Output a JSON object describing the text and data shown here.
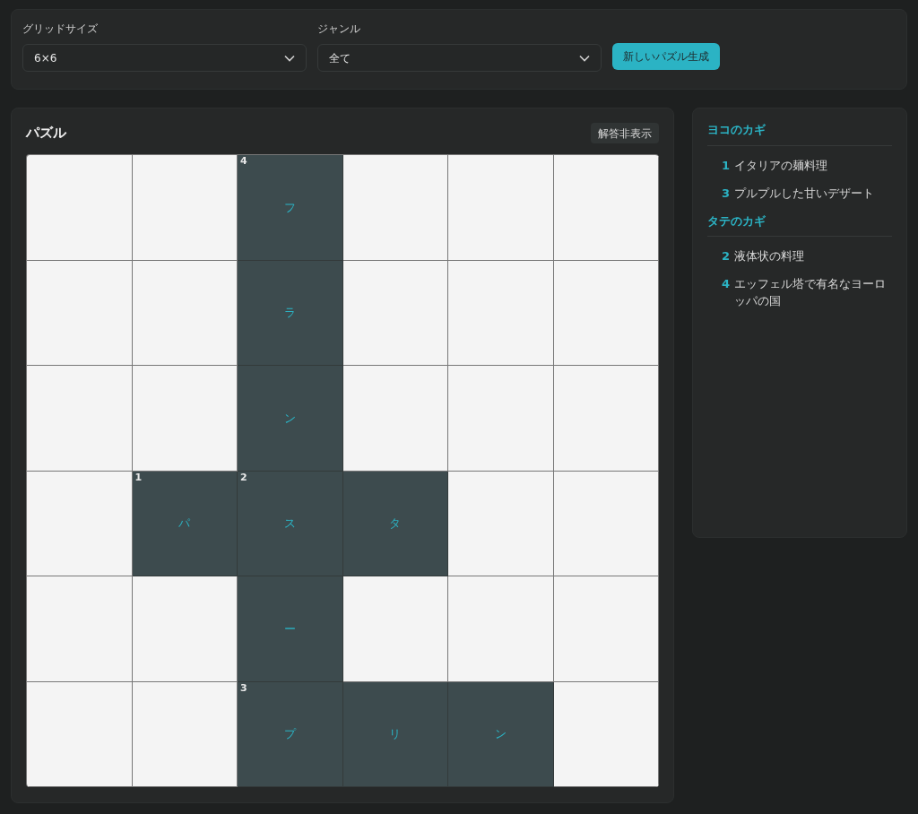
{
  "controls": {
    "grid_size": {
      "label": "グリッドサイズ",
      "value": "6×6"
    },
    "genre": {
      "label": "ジャンル",
      "value": "全て"
    },
    "generate_button": "新しいパズル生成"
  },
  "puzzle": {
    "title": "パズル",
    "toggle_answer_button": "解答非表示",
    "rows": [
      [
        {
          "kind": "blank"
        },
        {
          "kind": "blank"
        },
        {
          "kind": "letter",
          "number": "4",
          "letter": "フ"
        },
        {
          "kind": "blank"
        },
        {
          "kind": "blank"
        },
        {
          "kind": "blank"
        }
      ],
      [
        {
          "kind": "blank"
        },
        {
          "kind": "blank"
        },
        {
          "kind": "letter",
          "letter": "ラ"
        },
        {
          "kind": "blank"
        },
        {
          "kind": "blank"
        },
        {
          "kind": "blank"
        }
      ],
      [
        {
          "kind": "blank"
        },
        {
          "kind": "blank"
        },
        {
          "kind": "letter",
          "letter": "ン"
        },
        {
          "kind": "blank"
        },
        {
          "kind": "blank"
        },
        {
          "kind": "blank"
        }
      ],
      [
        {
          "kind": "blank"
        },
        {
          "kind": "letter",
          "number": "1",
          "letter": "パ"
        },
        {
          "kind": "letter",
          "number": "2",
          "letter": "ス"
        },
        {
          "kind": "letter",
          "letter": "タ"
        },
        {
          "kind": "blank"
        },
        {
          "kind": "blank"
        }
      ],
      [
        {
          "kind": "blank"
        },
        {
          "kind": "blank"
        },
        {
          "kind": "letter",
          "letter": "ー"
        },
        {
          "kind": "blank"
        },
        {
          "kind": "blank"
        },
        {
          "kind": "blank"
        }
      ],
      [
        {
          "kind": "blank"
        },
        {
          "kind": "blank"
        },
        {
          "kind": "letter",
          "number": "3",
          "letter": "プ"
        },
        {
          "kind": "letter",
          "letter": "リ"
        },
        {
          "kind": "letter",
          "letter": "ン"
        },
        {
          "kind": "blank"
        }
      ]
    ]
  },
  "clues": [
    {
      "heading": "ヨコのカギ",
      "items": [
        {
          "number": "1",
          "text": "イタリアの麺料理"
        },
        {
          "number": "3",
          "text": "プルプルした甘いデザート"
        }
      ]
    },
    {
      "heading": "タテのカギ",
      "items": [
        {
          "number": "2",
          "text": "液体状の料理"
        },
        {
          "number": "4",
          "text": "エッフェル塔で有名なヨーロッパの国"
        }
      ]
    }
  ]
}
